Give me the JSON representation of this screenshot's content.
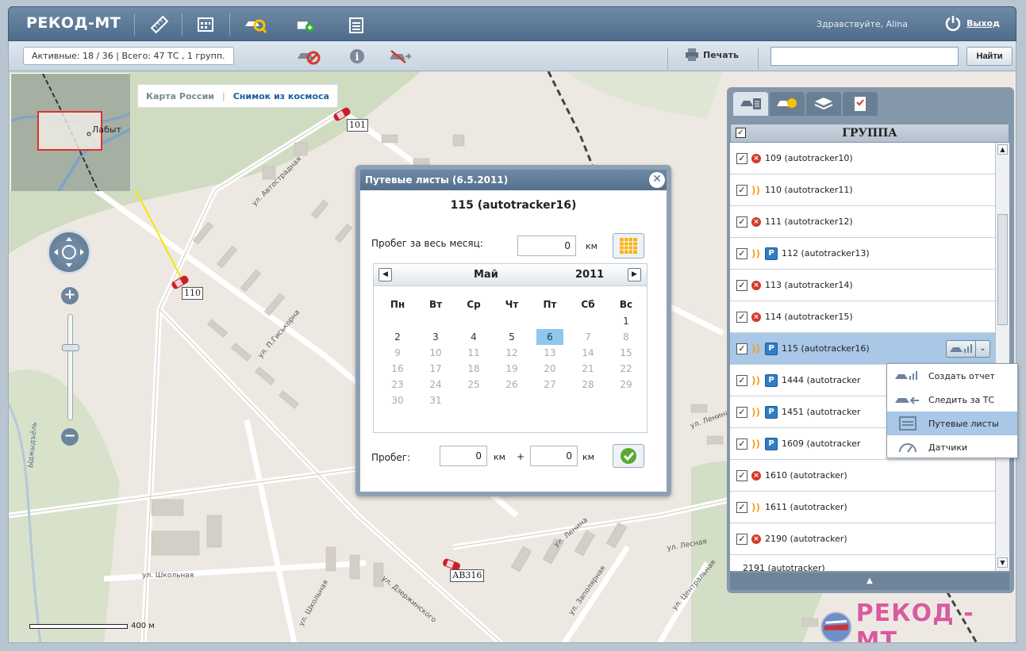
{
  "header": {
    "brand": "РЕКОД-МТ",
    "greeting": "Здравствуйте, Alina",
    "logout_label": "Выход"
  },
  "toolbar": {
    "stats": "Активные: 18 / 36  |  Всего: 47 ТС , 1 групп.",
    "print_label": "Печать",
    "search_value": "",
    "search_button": "Найти"
  },
  "map": {
    "layer_russia": "Карта России",
    "layer_sep": "|",
    "layer_space": "Снимок из космоса",
    "scale_label": "400 м",
    "minimap_label": "Лабыт",
    "vehicles": [
      "101",
      "110",
      "АВ316"
    ],
    "streets": [
      "ул. Автострадная",
      "ул. П.Гиськорна",
      "ул. Дзержинского",
      "ул. Школьная",
      "ул. Ленина",
      "ул. Лесная",
      "ул. Заполярная",
      "ул. Центральная",
      "Ыджыдъёль"
    ],
    "logo_text": "РЕКОД - МТ"
  },
  "dialog": {
    "header": "Путевые листы (6.5.2011)",
    "title": "115 (autotracker16)",
    "month_run_label": "Пробег за весь месяц:",
    "month_run_value": "0",
    "unit": "км",
    "calendar": {
      "month": "Май",
      "year": "2011",
      "weekdays": [
        "Пн",
        "Вт",
        "Ср",
        "Чт",
        "Пт",
        "Сб",
        "Вс"
      ],
      "selected_day": "6"
    },
    "run_label": "Пробег:",
    "run_a": "0",
    "run_plus": "+",
    "run_b": "0"
  },
  "panel": {
    "group_title": "ГРУППА",
    "rows": [
      {
        "label": "109 (autotracker10)",
        "status": "off",
        "parking": false
      },
      {
        "label": "110 (autotracker11)",
        "status": "on",
        "parking": false
      },
      {
        "label": "111 (autotracker12)",
        "status": "off",
        "parking": false
      },
      {
        "label": "112 (autotracker13)",
        "status": "on",
        "parking": true
      },
      {
        "label": "113 (autotracker14)",
        "status": "off",
        "parking": false
      },
      {
        "label": "114 (autotracker15)",
        "status": "off",
        "parking": false
      },
      {
        "label": "115 (autotracker16)",
        "status": "on",
        "parking": true
      },
      {
        "label": "1444 (autotracker",
        "status": "on",
        "parking": true
      },
      {
        "label": "1451 (autotracker",
        "status": "on",
        "parking": true
      },
      {
        "label": "1609 (autotracker",
        "status": "on",
        "parking": true
      },
      {
        "label": "1610 (autotracker)",
        "status": "off",
        "parking": false
      },
      {
        "label": "1611 (autotracker)",
        "status": "on",
        "parking": false
      },
      {
        "label": "2190 (autotracker)",
        "status": "off",
        "parking": false
      },
      {
        "label": "2191 (autotracker)",
        "status": "none",
        "parking": false
      }
    ],
    "context_menu": [
      "Создать отчет",
      "Следить за ТС",
      "Путевые листы",
      "Датчики"
    ]
  },
  "colors": {
    "header_blue": "#55708d",
    "selection": "#a9c7e6",
    "calendar_selected": "#8cc8f0",
    "offline_red": "#d23a2c",
    "online_orange": "#f2a020",
    "parking_blue": "#2f7fc8"
  }
}
